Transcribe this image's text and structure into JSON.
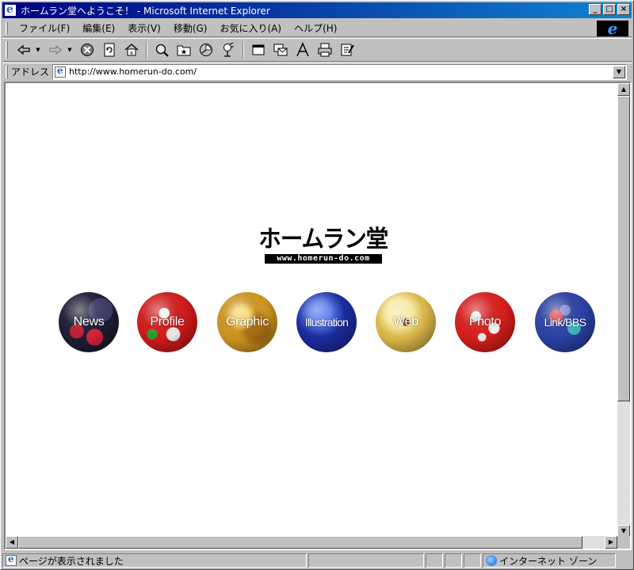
{
  "window": {
    "title": "ホームラン堂へようこそ！ - Microsoft Internet Explorer",
    "minimize_label": "_",
    "maximize_label": "□",
    "close_label": "×"
  },
  "menu": {
    "items": [
      {
        "label": "ファイル(F)"
      },
      {
        "label": "編集(E)"
      },
      {
        "label": "表示(V)"
      },
      {
        "label": "移動(G)"
      },
      {
        "label": "お気に入り(A)"
      },
      {
        "label": "ヘルプ(H)"
      }
    ]
  },
  "address": {
    "label": "アドレス",
    "url": "http://www.homerun-do.com/"
  },
  "page": {
    "logo_title": "ホームラン堂",
    "logo_url": "www.homerun-do.com",
    "balls": [
      {
        "label": "News"
      },
      {
        "label": "Profile"
      },
      {
        "label": "Graphic"
      },
      {
        "label": "Illustration"
      },
      {
        "label": "Web"
      },
      {
        "label": "Photo"
      },
      {
        "label": "Link/BBS"
      }
    ]
  },
  "status": {
    "message": "ページが表示されました",
    "zone": "インターネット ゾーン"
  }
}
